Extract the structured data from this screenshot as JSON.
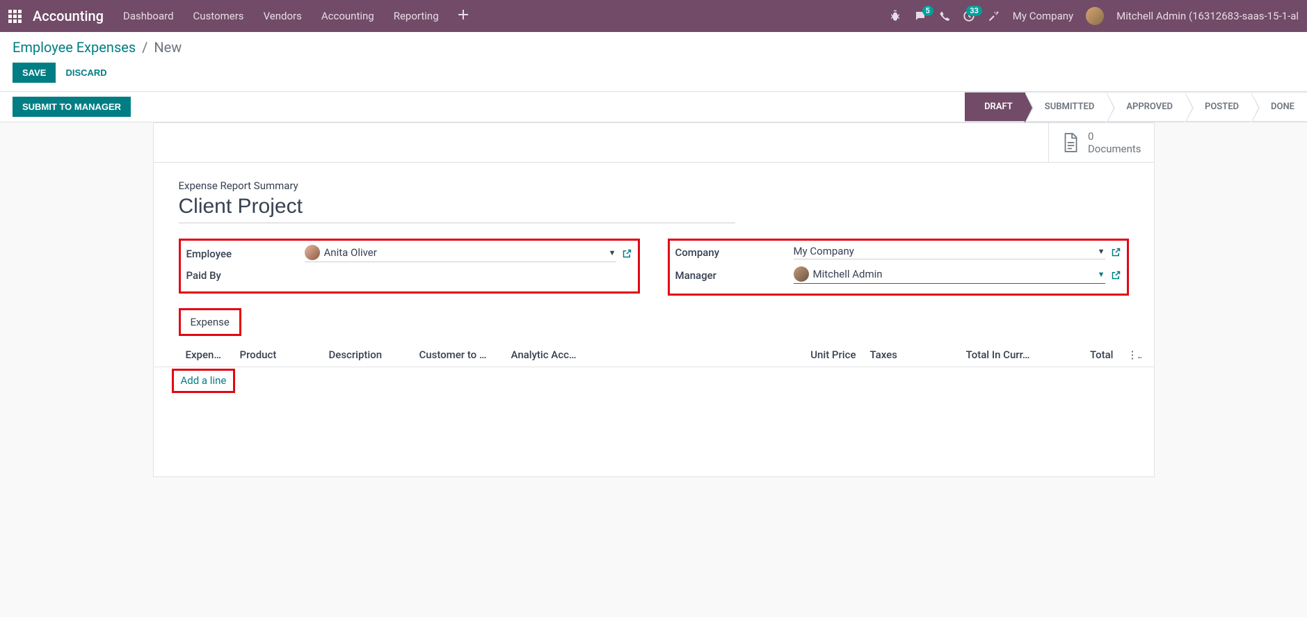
{
  "topnav": {
    "brand": "Accounting",
    "items": [
      "Dashboard",
      "Customers",
      "Vendors",
      "Accounting",
      "Reporting"
    ],
    "msg_badge": "5",
    "activity_badge": "33",
    "company": "My Company",
    "user": "Mitchell Admin (16312683-saas-15-1-al"
  },
  "breadcrumb": {
    "parent": "Employee Expenses",
    "current": "New"
  },
  "buttons": {
    "save": "SAVE",
    "discard": "DISCARD",
    "submit": "SUBMIT TO MANAGER"
  },
  "status": {
    "steps": [
      "DRAFT",
      "SUBMITTED",
      "APPROVED",
      "POSTED",
      "DONE"
    ],
    "active_index": 0
  },
  "docs": {
    "count": "0",
    "label": "Documents"
  },
  "form": {
    "summary_label": "Expense Report Summary",
    "title": "Client Project",
    "left": {
      "employee_label": "Employee",
      "employee_value": "Anita Oliver",
      "paidby_label": "Paid By"
    },
    "right": {
      "company_label": "Company",
      "company_value": "My Company",
      "manager_label": "Manager",
      "manager_value": "Mitchell Admin"
    }
  },
  "tab": {
    "label": "Expense"
  },
  "columns": {
    "c1": "Expen…",
    "c2": "Product",
    "c3": "Description",
    "c4": "Customer to …",
    "c5": "Analytic Acc…",
    "c7": "Unit Price",
    "c8": "Taxes",
    "c9": "Total In Curr…",
    "c10": "Total"
  },
  "add_line": "Add a line"
}
